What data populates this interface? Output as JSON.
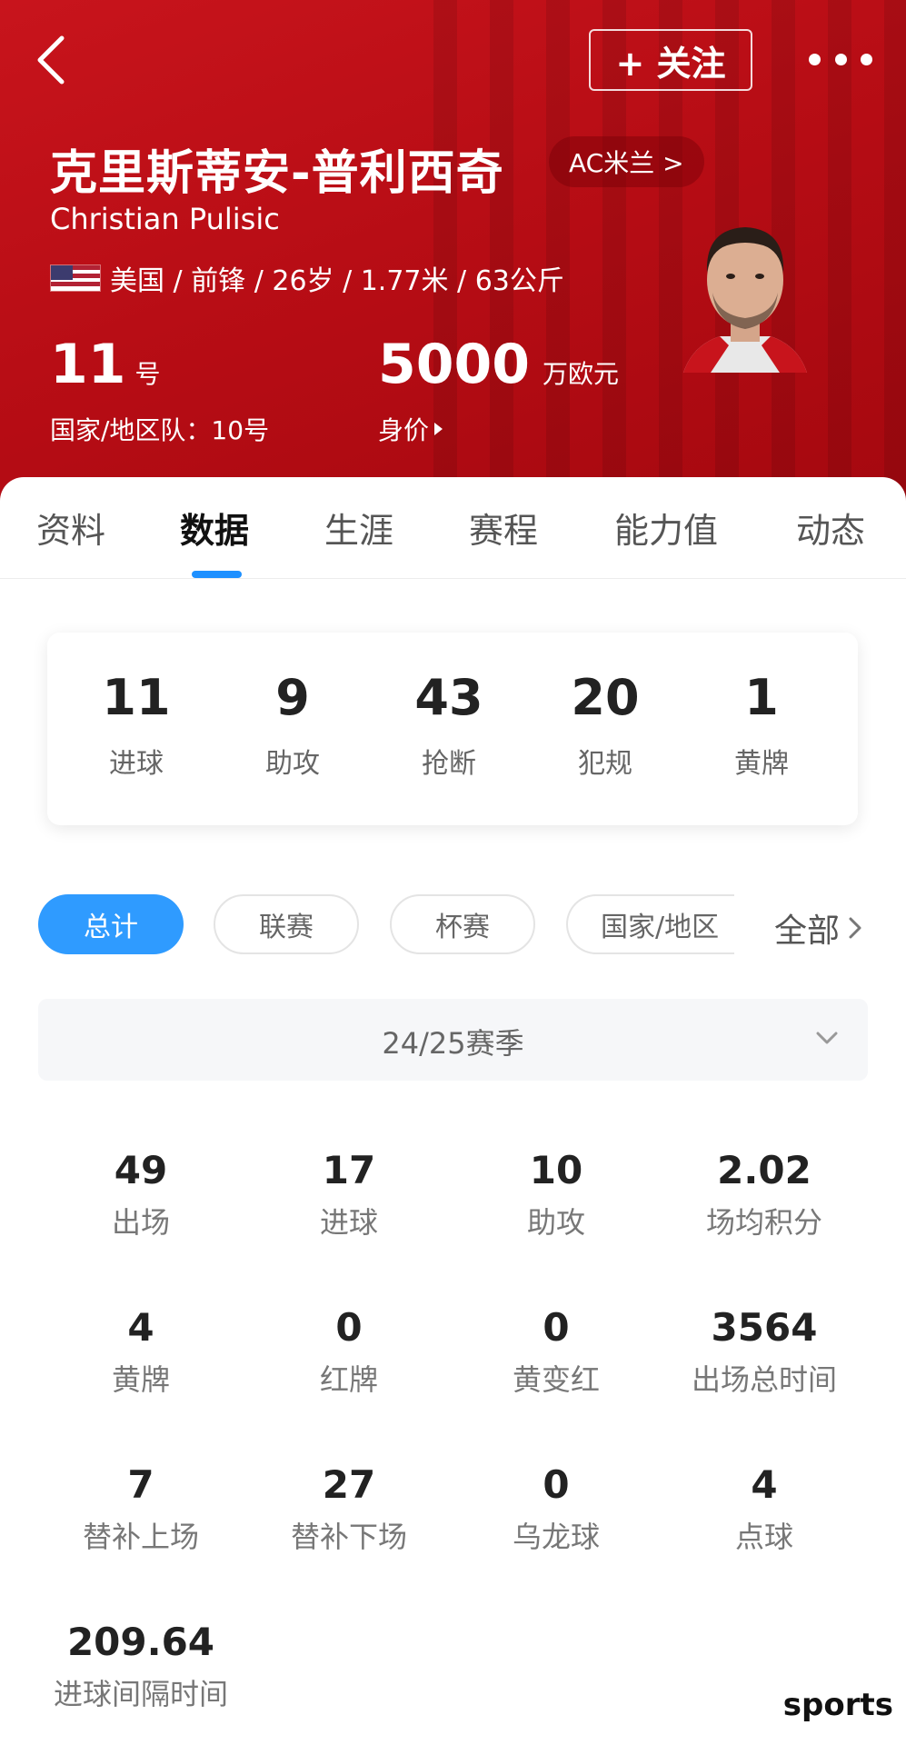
{
  "header": {
    "follow_label": "+ 关注",
    "name_cn": "克里斯蒂安-普利西奇",
    "club": "AC米兰 >",
    "name_en": "Christian Pulisic",
    "info": "美国 / 前锋 / 26岁 / 1.77米 / 63公斤",
    "jersey_number": "11",
    "jersey_unit": "号",
    "national_team": "国家/地区队：10号",
    "market_value": "5000",
    "market_value_unit": "万欧元",
    "market_value_label": "身价"
  },
  "tabs": [
    "资料",
    "数据",
    "生涯",
    "赛程",
    "能力值",
    "动态"
  ],
  "active_tab": "数据",
  "summary": [
    {
      "value": "11",
      "label": "进球"
    },
    {
      "value": "9",
      "label": "助攻"
    },
    {
      "value": "43",
      "label": "抢断"
    },
    {
      "value": "20",
      "label": "犯规"
    },
    {
      "value": "1",
      "label": "黄牌"
    }
  ],
  "filters": [
    "总计",
    "联赛",
    "杯赛",
    "国家/地区"
  ],
  "active_filter": "总计",
  "filter_all": "全部",
  "season": "24/25赛季",
  "stats": [
    {
      "value": "49",
      "label": "出场"
    },
    {
      "value": "17",
      "label": "进球"
    },
    {
      "value": "10",
      "label": "助攻"
    },
    {
      "value": "2.02",
      "label": "场均积分"
    },
    {
      "value": "4",
      "label": "黄牌"
    },
    {
      "value": "0",
      "label": "红牌"
    },
    {
      "value": "0",
      "label": "黄变红"
    },
    {
      "value": "3564",
      "label": "出场总时间"
    },
    {
      "value": "7",
      "label": "替补上场"
    },
    {
      "value": "27",
      "label": "替补下场"
    },
    {
      "value": "0",
      "label": "乌龙球"
    },
    {
      "value": "4",
      "label": "点球"
    },
    {
      "value": "209.64",
      "label": "进球间隔时间"
    }
  ],
  "watermark": "sports",
  "colors": {
    "header_red": "#b80d15",
    "accent_blue": "#2f9bff"
  }
}
